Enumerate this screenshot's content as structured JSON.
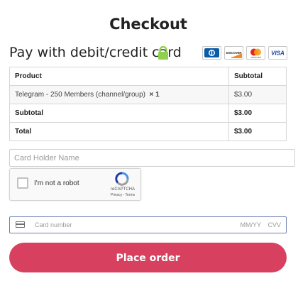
{
  "page": {
    "title": "Checkout"
  },
  "payment": {
    "heading": "Pay with debit/credit card",
    "cards": [
      {
        "name": "diners-club-icon"
      },
      {
        "name": "discover-icon"
      },
      {
        "name": "mastercard-icon"
      },
      {
        "name": "visa-icon"
      }
    ],
    "card_labels": {
      "discover": "DISCOVER",
      "mastercard": "mastercard",
      "visa": "VISA"
    }
  },
  "order": {
    "headers": {
      "product": "Product",
      "subtotal": "Subtotal"
    },
    "item": {
      "name": "Telegram - 250 Members (channel/group)",
      "qty": "× 1",
      "price": "$3.00"
    },
    "subtotal": {
      "label": "Subtotal",
      "value": "$3.00"
    },
    "total": {
      "label": "Total",
      "value": "$3.00"
    }
  },
  "form": {
    "holder_placeholder": "Card Holder Name",
    "card_placeholder": "Card number",
    "expiry_placeholder": "MM/YY",
    "cvv_placeholder": "CVV"
  },
  "captcha": {
    "label": "I'm not a robot",
    "brand": "reCAPTCHA",
    "links": "Privacy - Terms"
  },
  "actions": {
    "place_order": "Place order"
  },
  "colors": {
    "accent": "#d8405f",
    "lock": "#8fd14f",
    "card_field_border": "#6b7fb0",
    "visa": "#1a3f96",
    "diners": "#0a5ba8"
  }
}
